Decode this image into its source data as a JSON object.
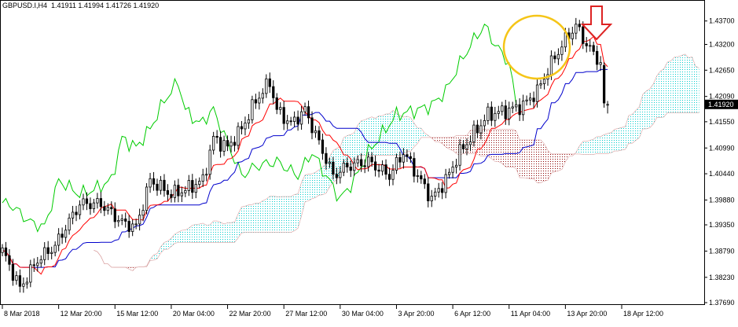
{
  "header": {
    "symbol": "GBPUSD.I,H4",
    "open": "1.41911",
    "high": "1.41994",
    "low": "1.41726",
    "close": "1.41920"
  },
  "current_price_label": "1.41920",
  "colors": {
    "bull_candle": "#000000",
    "bear_candle": "#000000",
    "tenkan": "#ff0000",
    "kijun": "#0000cc",
    "chikou": "#00cc00",
    "cloud_bear": "#8b0000",
    "cloud_bull": "#00cccc",
    "highlight_circle": "#f5c518",
    "arrow": "#dd2222",
    "price_tag_bg": "#000000",
    "price_tag_text": "#ffffff"
  },
  "chart_data": {
    "type": "candlestick",
    "ylim": [
      1.3769,
      1.4398
    ],
    "y_ticks": [
      "1.43700",
      "1.43200",
      "1.42650",
      "1.42090",
      "1.41550",
      "1.40990",
      "1.40440",
      "1.39880",
      "1.39350",
      "1.38790",
      "1.38230",
      "1.37690"
    ],
    "y_tick_values": [
      1.437,
      1.432,
      1.4265,
      1.4209,
      1.4155,
      1.4099,
      1.4044,
      1.3988,
      1.3935,
      1.3879,
      1.3823,
      1.3769
    ],
    "x_labels": [
      "8 Mar 2018",
      "12 Mar 20:00",
      "15 Mar 12:00",
      "20 Mar 04:00",
      "22 Mar 20:00",
      "27 Mar 12:00",
      "30 Mar 04:00",
      "3 Apr 20:00",
      "6 Apr 12:00",
      "11 Apr 04:00",
      "13 Apr 20:00",
      "18 Apr 12:00"
    ],
    "x_label_bars": [
      0,
      16,
      32,
      48,
      64,
      80,
      96,
      112,
      128,
      144,
      160,
      176
    ],
    "bar_count": 200,
    "shift": 26,
    "close_anchors": [
      [
        0,
        1.388
      ],
      [
        5,
        1.38
      ],
      [
        10,
        1.386
      ],
      [
        15,
        1.389
      ],
      [
        18,
        1.393
      ],
      [
        22,
        1.398
      ],
      [
        28,
        1.398
      ],
      [
        34,
        1.394
      ],
      [
        38,
        1.393
      ],
      [
        42,
        1.403
      ],
      [
        48,
        1.4
      ],
      [
        52,
        1.401
      ],
      [
        57,
        1.403
      ],
      [
        60,
        1.412
      ],
      [
        64,
        1.41
      ],
      [
        68,
        1.414
      ],
      [
        72,
        1.42
      ],
      [
        76,
        1.424
      ],
      [
        78,
        1.418
      ],
      [
        82,
        1.415
      ],
      [
        86,
        1.418
      ],
      [
        90,
        1.411
      ],
      [
        94,
        1.404
      ],
      [
        98,
        1.406
      ],
      [
        104,
        1.407
      ],
      [
        110,
        1.404
      ],
      [
        114,
        1.409
      ],
      [
        118,
        1.404
      ],
      [
        122,
        1.399
      ],
      [
        126,
        1.403
      ],
      [
        130,
        1.409
      ],
      [
        134,
        1.413
      ],
      [
        138,
        1.417
      ],
      [
        144,
        1.418
      ],
      [
        148,
        1.419
      ],
      [
        152,
        1.422
      ],
      [
        156,
        1.428
      ],
      [
        160,
        1.433
      ],
      [
        163,
        1.436
      ],
      [
        166,
        1.432
      ],
      [
        170,
        1.428
      ],
      [
        172,
        1.4192
      ]
    ],
    "last_candle": {
      "open": 1.41911,
      "high": 1.41994,
      "low": 1.41726,
      "close": 1.4192
    }
  }
}
